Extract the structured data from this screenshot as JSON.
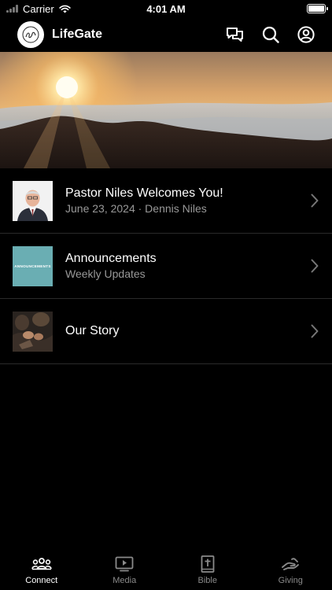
{
  "status": {
    "carrier": "Carrier",
    "time": "4:01 AM"
  },
  "header": {
    "title": "LifeGate",
    "icons": [
      "chat-icon",
      "search-icon",
      "profile-icon"
    ]
  },
  "feed": {
    "items": [
      {
        "title": "Pastor Niles Welcomes You!",
        "subtitle": "June 23, 2024 · Dennis Niles",
        "thumb": "pastor-photo"
      },
      {
        "title": "Announcements",
        "subtitle": "Weekly Updates",
        "thumb": "announcements-graphic",
        "thumb_text": "ANNOUNCEMENTS"
      },
      {
        "title": "Our Story",
        "subtitle": "",
        "thumb": "worship-photo"
      }
    ]
  },
  "tabs": [
    {
      "label": "Connect",
      "icon": "group-icon",
      "active": true
    },
    {
      "label": "Media",
      "icon": "video-icon",
      "active": false
    },
    {
      "label": "Bible",
      "icon": "bible-icon",
      "active": false
    },
    {
      "label": "Giving",
      "icon": "hands-icon",
      "active": false
    }
  ],
  "colors": {
    "background": "#000000",
    "text_secondary": "#999999",
    "tab_inactive": "#8a8a8a",
    "announcement_teal": "#6aaeb3"
  }
}
